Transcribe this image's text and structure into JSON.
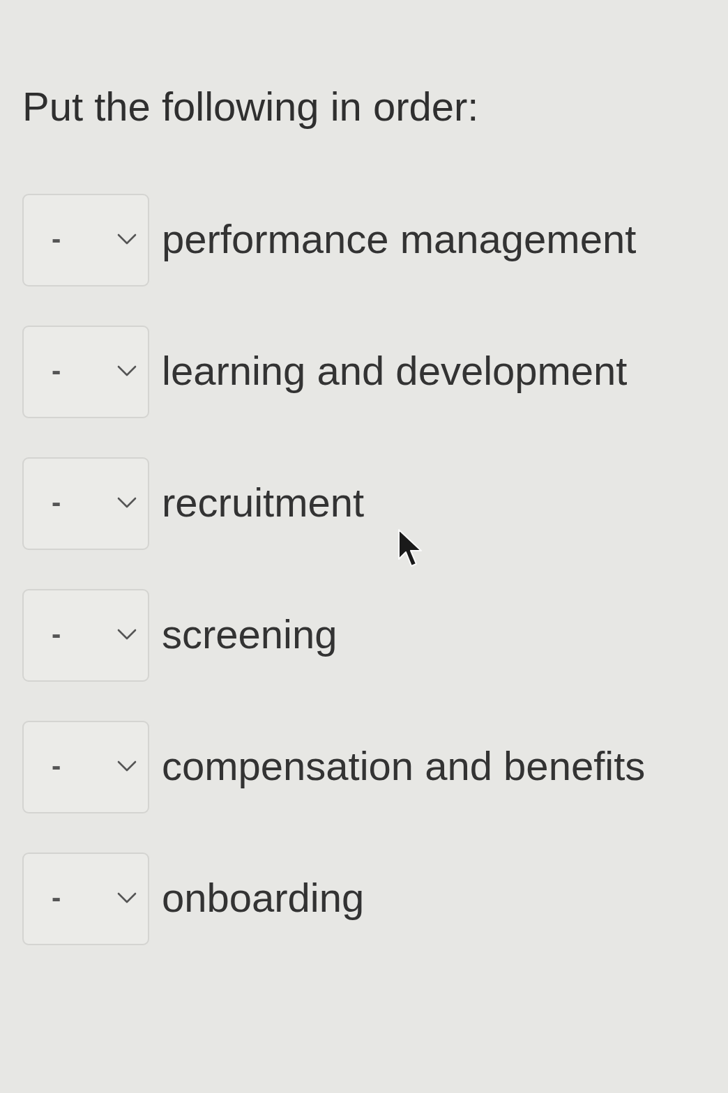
{
  "question": {
    "prompt": "Put the following in order:"
  },
  "items": [
    {
      "value": "-",
      "label": "performance management"
    },
    {
      "value": "-",
      "label": "learning and development"
    },
    {
      "value": "-",
      "label": "recruitment"
    },
    {
      "value": "-",
      "label": "screening"
    },
    {
      "value": "-",
      "label": "compensation and benefits"
    },
    {
      "value": "-",
      "label": "onboarding"
    }
  ]
}
